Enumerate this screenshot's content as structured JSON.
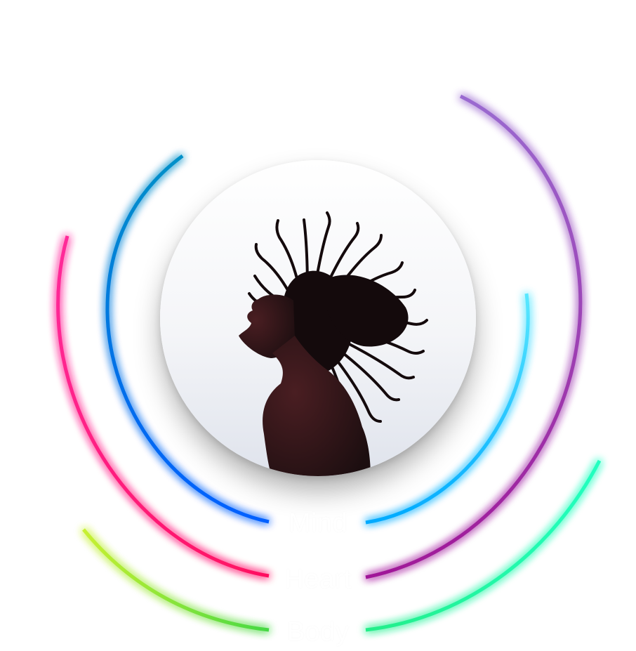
{
  "labels": {
    "mind": "Mind",
    "heart": "Heart",
    "body": "Body"
  },
  "colors": {
    "blue_start": "#00a8d8",
    "blue_end": "#0066ff",
    "pink": "#ff1f7e",
    "purple_start": "#9b59c4",
    "purple_end": "#a020a8",
    "cyan_start": "#4de8ff",
    "cyan_end": "#00b8ff",
    "lime": "#b8f035",
    "green": "#33dd44",
    "teal": "#22ffbb"
  },
  "photo": {
    "subject": "woman-silhouette-hair-flip"
  }
}
